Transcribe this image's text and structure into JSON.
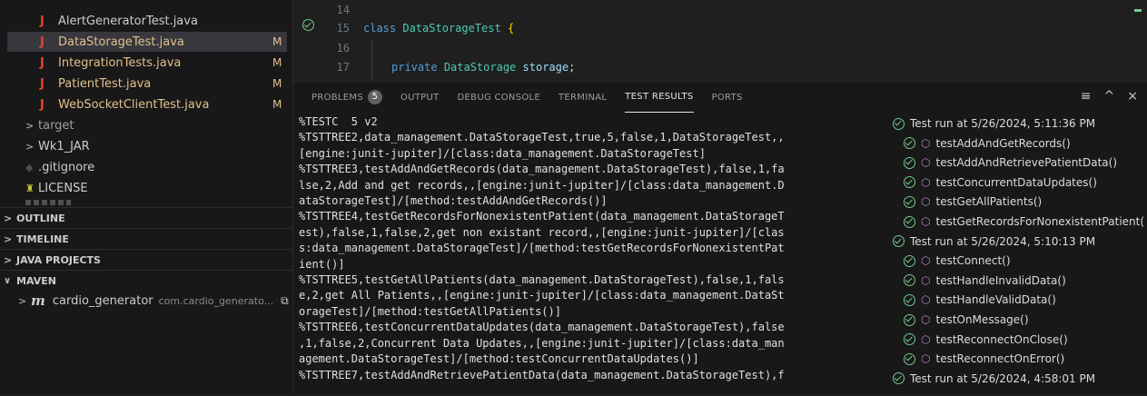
{
  "explorer": {
    "files": [
      {
        "name": "AlertGeneratorTest.java",
        "status": ""
      },
      {
        "name": "DataStorageTest.java",
        "status": "M"
      },
      {
        "name": "IntegrationTests.java",
        "status": "M"
      },
      {
        "name": "PatientTest.java",
        "status": "M"
      },
      {
        "name": "WebSocketClientTest.java",
        "status": "M"
      }
    ],
    "file_icon": "J",
    "tree": [
      {
        "name": "target",
        "chevron": ">"
      },
      {
        "name": "Wk1_JAR",
        "chevron": ">"
      },
      {
        "name": ".gitignore",
        "chevron": ""
      },
      {
        "name": "LICENSE",
        "chevron": ""
      }
    ],
    "sections": [
      "OUTLINE",
      "TIMELINE",
      "JAVA PROJECTS",
      "MAVEN"
    ],
    "maven_project": {
      "name": "cardio_generator",
      "group": "com.cardio_generato..."
    }
  },
  "editor": {
    "lines": [
      {
        "num": "14",
        "code": ""
      },
      {
        "num": "15",
        "keyword": "class",
        "ident": "DataStorageTest",
        "punct": " {"
      },
      {
        "num": "16",
        "code": ""
      },
      {
        "num": "17",
        "keyword": "private",
        "ident": "DataStorage",
        "var": "storage",
        "punct": ";"
      }
    ]
  },
  "panel": {
    "tabs": [
      {
        "label": "PROBLEMS",
        "badge": "5"
      },
      {
        "label": "OUTPUT"
      },
      {
        "label": "DEBUG CONSOLE"
      },
      {
        "label": "TERMINAL"
      },
      {
        "label": "TEST RESULTS",
        "active": true
      },
      {
        "label": "PORTS"
      }
    ],
    "actions": [
      "≡",
      "^",
      "×"
    ],
    "output_lines": [
      "%TESTC  5 v2",
      "%TSTTREE2,data_management.DataStorageTest,true,5,false,1,DataStorageTest,,",
      "[engine:junit-jupiter]/[class:data_management.DataStorageTest]",
      "%TSTTREE3,testAddAndGetRecords(data_management.DataStorageTest),false,1,fa",
      "lse,2,Add and get records,,[engine:junit-jupiter]/[class:data_management.D",
      "ataStorageTest]/[method:testAddAndGetRecords()]",
      "%TSTTREE4,testGetRecordsForNonexistentPatient(data_management.DataStorageT",
      "est),false,1,false,2,get non existant record,,[engine:junit-jupiter]/[clas",
      "s:data_management.DataStorageTest]/[method:testGetRecordsForNonexistentPat",
      "ient()]",
      "%TSTTREE5,testGetAllPatients(data_management.DataStorageTest),false,1,fals",
      "e,2,get All Patients,,[engine:junit-jupiter]/[class:data_management.DataSt",
      "orageTest]/[method:testGetAllPatients()]",
      "%TSTTREE6,testConcurrentDataUpdates(data_management.DataStorageTest),false",
      ",1,false,2,Concurrent Data Updates,,[engine:junit-jupiter]/[class:data_man",
      "agement.DataStorageTest]/[method:testConcurrentDataUpdates()]",
      "%TSTTREE7,testAddAndRetrievePatientData(data_management.DataStorageTest),f"
    ],
    "results": [
      {
        "label": "Test run at 5/26/2024, 5:11:36 PM",
        "level": 0
      },
      {
        "label": "testAddAndGetRecords()",
        "level": 1
      },
      {
        "label": "testAddAndRetrievePatientData()",
        "level": 1
      },
      {
        "label": "testConcurrentDataUpdates()",
        "level": 1
      },
      {
        "label": "testGetAllPatients()",
        "level": 1
      },
      {
        "label": "testGetRecordsForNonexistentPatient(",
        "level": 1
      },
      {
        "label": "Test run at 5/26/2024, 5:10:13 PM",
        "level": 0
      },
      {
        "label": "testConnect()",
        "level": 1
      },
      {
        "label": "testHandleInvalidData()",
        "level": 1
      },
      {
        "label": "testHandleValidData()",
        "level": 1
      },
      {
        "label": "testOnMessage()",
        "level": 1
      },
      {
        "label": "testReconnectOnClose()",
        "level": 1
      },
      {
        "label": "testReconnectOnError()",
        "level": 1
      },
      {
        "label": "Test run at 5/26/2024, 4:58:01 PM",
        "level": 0
      }
    ]
  },
  "colors": {
    "accent": "#73c991",
    "modified": "#e2c08d",
    "java": "#e8412f",
    "keyword": "#569cd6",
    "type": "#4ec9b0",
    "variable": "#9cdcfe"
  }
}
